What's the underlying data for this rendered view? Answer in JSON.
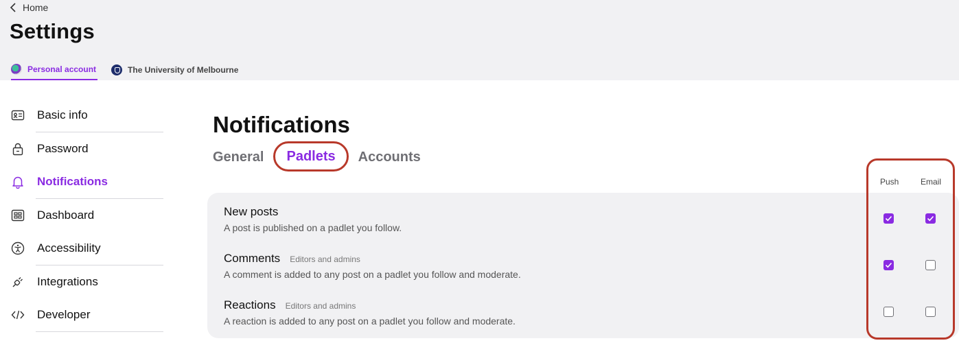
{
  "header": {
    "back_label": "Home",
    "title": "Settings",
    "accounts": [
      {
        "label": "Personal account",
        "active": true
      },
      {
        "label": "The University of Melbourne",
        "active": false
      }
    ]
  },
  "sidebar": {
    "items": [
      {
        "label": "Basic info",
        "icon": "id-card-icon"
      },
      {
        "label": "Password",
        "icon": "lock-icon"
      },
      {
        "label": "Notifications",
        "icon": "bell-icon",
        "active": true
      },
      {
        "label": "Dashboard",
        "icon": "dashboard-icon"
      },
      {
        "label": "Accessibility",
        "icon": "accessibility-icon"
      },
      {
        "label": "Integrations",
        "icon": "plug-icon"
      },
      {
        "label": "Developer",
        "icon": "code-icon"
      }
    ]
  },
  "main": {
    "title": "Notifications",
    "tabs": [
      {
        "label": "General",
        "active": false
      },
      {
        "label": "Padlets",
        "active": true
      },
      {
        "label": "Accounts",
        "active": false
      }
    ],
    "columns": {
      "push": "Push",
      "email": "Email"
    },
    "rows": [
      {
        "title": "New posts",
        "tag": "",
        "description": "A post is published on a padlet you follow.",
        "push": true,
        "email": true
      },
      {
        "title": "Comments",
        "tag": "Editors and admins",
        "description": "A comment is added to any post on a padlet you follow and moderate.",
        "push": true,
        "email": false
      },
      {
        "title": "Reactions",
        "tag": "Editors and admins",
        "description": "A reaction is added to any post on a padlet you follow and moderate.",
        "push": false,
        "email": false
      }
    ]
  },
  "colors": {
    "accent": "#8a2be2",
    "highlight": "#b8392a",
    "panel": "#f1f1f3"
  }
}
